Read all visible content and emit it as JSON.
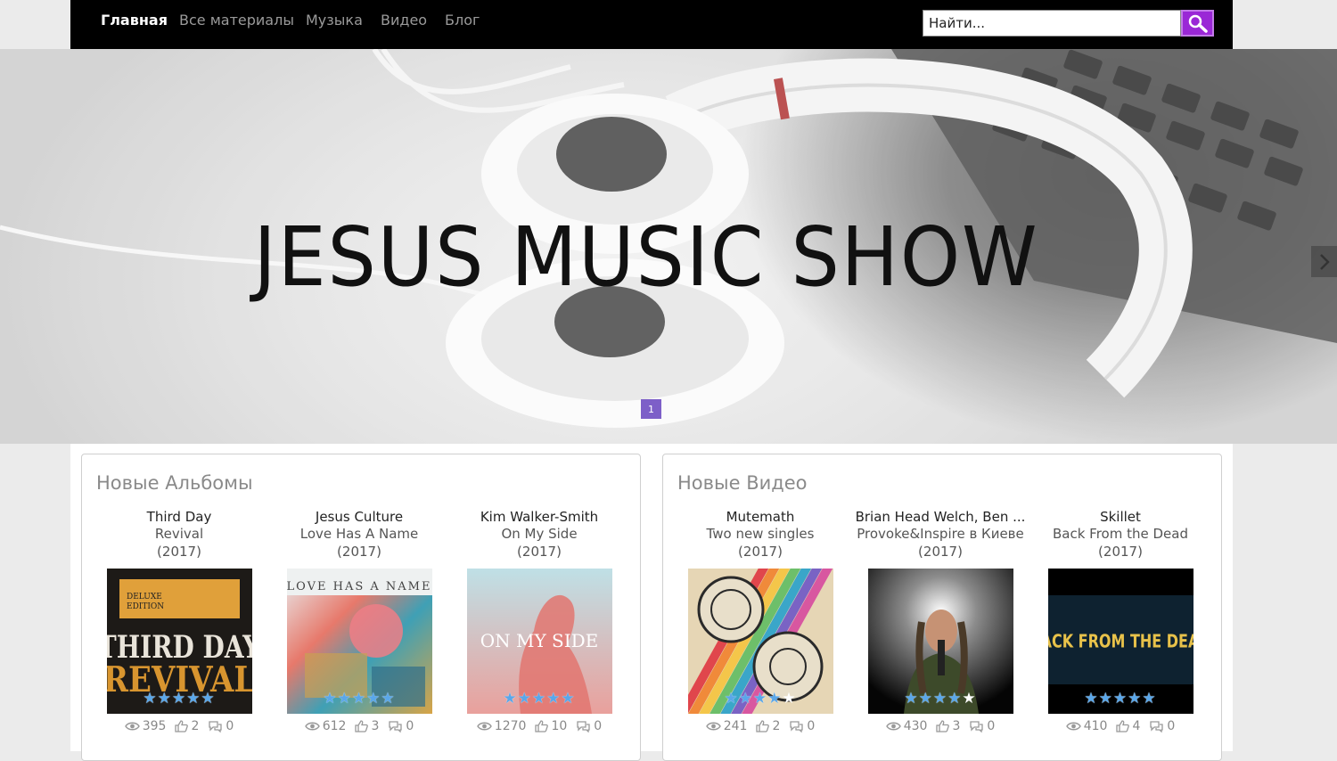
{
  "nav": {
    "items": [
      "Главная",
      "Все материалы",
      "Музыка",
      "Видео",
      "Блог"
    ],
    "active_index": 0,
    "search_placeholder": "Найти...",
    "search_button_color": "#9a27d6"
  },
  "hero": {
    "title": "JESUS MUSIC SHOW",
    "slide_indicator": "1",
    "next_icon": "chevron-right-icon"
  },
  "albums": {
    "title": "Новые Альбомы",
    "cards": [
      {
        "artist": "Third Day",
        "title": "Revival",
        "year": "(2017)",
        "cover_text": "THIRD DAY REVIVAL",
        "rating": 5,
        "views": "395",
        "likes": "2",
        "comments": "0"
      },
      {
        "artist": "Jesus Culture",
        "title": "Love Has A Name",
        "year": "(2017)",
        "cover_text": "LOVE HAS A NAME",
        "rating": 5,
        "views": "612",
        "likes": "3",
        "comments": "0"
      },
      {
        "artist": "Kim Walker-Smith",
        "title": "On My Side",
        "year": "(2017)",
        "cover_text": "ON MY SIDE",
        "rating": 5,
        "views": "1270",
        "likes": "10",
        "comments": "0"
      }
    ]
  },
  "videos": {
    "title": "Новые Видео",
    "cards": [
      {
        "artist": "Mutemath",
        "title": "Two new singles",
        "year": "(2017)",
        "rating": 4,
        "views": "241",
        "likes": "2",
        "comments": "0"
      },
      {
        "artist": "Brian Head Welch, Ben ...",
        "title": "Provoke&Inspire в Киеве",
        "year": "(2017)",
        "rating": 4,
        "views": "430",
        "likes": "3",
        "comments": "0"
      },
      {
        "artist": "Skillet",
        "title": "Back From the Dead",
        "year": "(2017)",
        "cover_text": "BACK FROM THE DEAD",
        "rating": 5,
        "views": "410",
        "likes": "4",
        "comments": "0"
      }
    ]
  },
  "colors": {
    "accent": "#9a27d6",
    "star": "#5aa7ea",
    "slide_dot": "#7d5fc8"
  }
}
